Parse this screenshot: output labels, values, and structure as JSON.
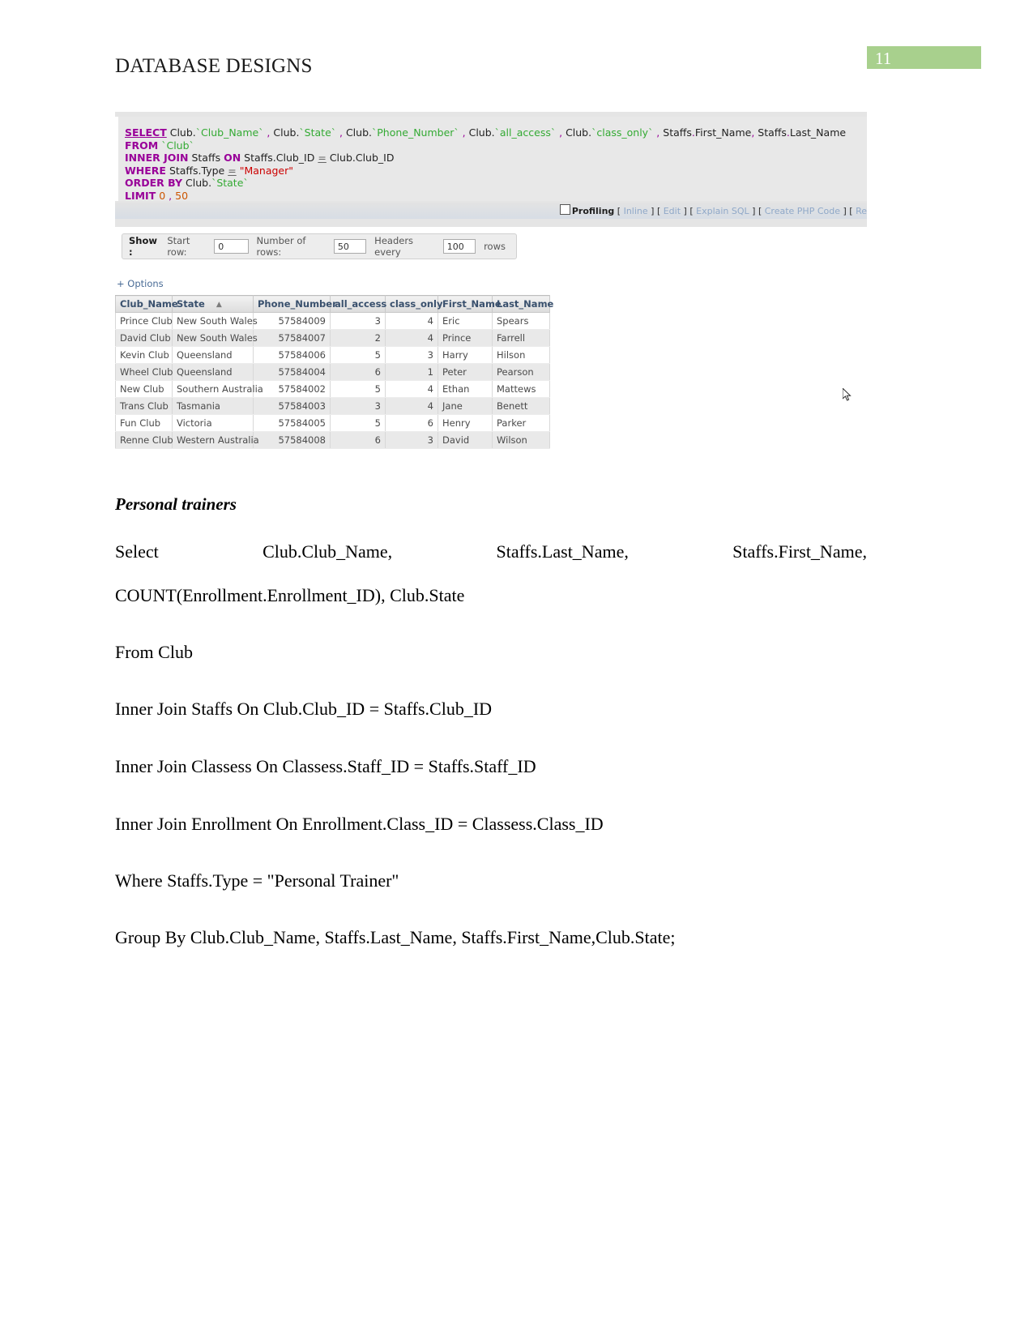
{
  "document": {
    "header_title": "DATABASE DESIGNS",
    "page_number": "11"
  },
  "sql_panel": {
    "query_lines": [
      "SELECT Club.`Club_Name` , Club.`State` , Club.`Phone_Number` , Club.`all_access` , Club.`class_only` , Staffs.First_Name, Staffs.Last_Name",
      "FROM `Club`",
      "INNER JOIN Staffs ON Staffs.Club_ID = Club.Club_ID",
      "WHERE Staffs.Type = \"Manager\"",
      "ORDER BY Club.`State`",
      "LIMIT 0 , 50"
    ],
    "links": {
      "profiling_label": "Profiling",
      "inline": "Inline",
      "edit": "Edit",
      "explain_sql": "Explain SQL",
      "create_php_code": "Create PHP Code",
      "truncated": "Re"
    }
  },
  "show_strip": {
    "show_label": "Show :",
    "start_row_label": "Start row:",
    "start_row_value": "0",
    "number_of_rows_label": "Number of rows:",
    "number_of_rows_value": "50",
    "headers_every_label": "Headers every",
    "headers_every_value": "100",
    "rows_label": "rows"
  },
  "options_link": "+ Options",
  "results_table": {
    "columns": [
      "Club_Name",
      "State",
      "Phone_Number",
      "all_access",
      "class_only",
      "First_Name",
      "Last_Name"
    ],
    "sorted_column": "State",
    "sort_direction_icon": "▲",
    "rows": [
      [
        "Prince Club",
        "New South Wales",
        "57584009",
        "3",
        "4",
        "Eric",
        "Spears"
      ],
      [
        "David Club",
        "New South Wales",
        "57584007",
        "2",
        "4",
        "Prince",
        "Farrell"
      ],
      [
        "Kevin Club",
        "Queensland",
        "57584006",
        "5",
        "3",
        "Harry",
        "Hilson"
      ],
      [
        "Wheel Club",
        "Queensland",
        "57584004",
        "6",
        "1",
        "Peter",
        "Pearson"
      ],
      [
        "New Club",
        "Southern Australia",
        "57584002",
        "5",
        "4",
        "Ethan",
        "Mattews"
      ],
      [
        "Trans Club",
        "Tasmania",
        "57584003",
        "3",
        "4",
        "Jane",
        "Benett"
      ],
      [
        "Fun Club",
        "Victoria",
        "57584005",
        "5",
        "6",
        "Henry",
        "Parker"
      ],
      [
        "Renne Club",
        "Western Australia",
        "57584008",
        "6",
        "3",
        "David",
        "Wilson"
      ]
    ]
  },
  "body": {
    "section_heading": "Personal trainers",
    "select_line_segments": [
      "Select",
      "Club.Club_Name,",
      "Staffs.Last_Name,",
      "Staffs.First_Name,"
    ],
    "select_line2": "COUNT(Enrollment.Enrollment_ID), Club.State",
    "from_line": "From Club",
    "join1_line": "Inner Join Staffs On Club.Club_ID = Staffs.Club_ID",
    "join2_line": "Inner Join Classess On Classess.Staff_ID = Staffs.Staff_ID",
    "join3_line": "Inner Join Enrollment On Enrollment.Class_ID = Classess.Class_ID",
    "where_line": "Where Staffs.Type = \"Personal Trainer\"",
    "groupby_line": "Group By Club.Club_Name, Staffs.Last_Name, Staffs.First_Name,Club.State;"
  }
}
